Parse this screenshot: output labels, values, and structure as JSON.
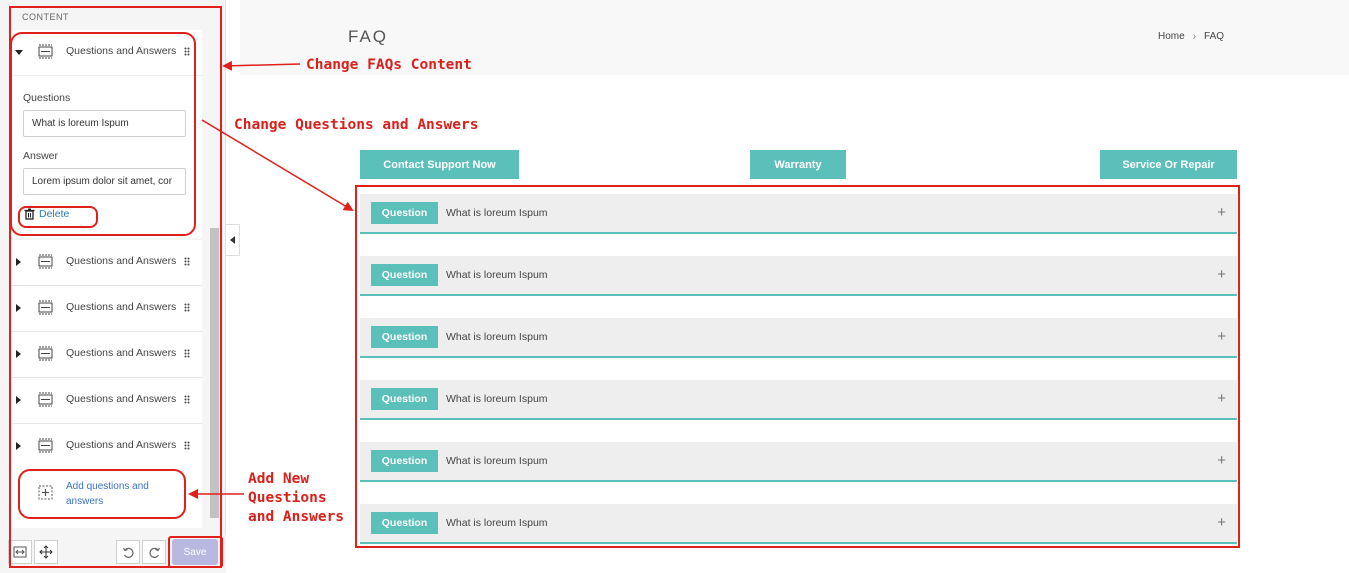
{
  "sidebar": {
    "section_label": "CONTENT",
    "item_label": "Questions and Answers",
    "expanded_item": {
      "question_label": "Questions",
      "question_value": "What is loreum Ispum",
      "answer_label": "Answer",
      "answer_value": "Lorem ipsum dolor sit amet, cor",
      "delete_label": "Delete"
    },
    "collapsed_items": [
      {
        "label": "Questions and Answers"
      },
      {
        "label": "Questions and Answers"
      },
      {
        "label": "Questions and Answers"
      },
      {
        "label": "Questions and Answers"
      },
      {
        "label": "Questions and Answers"
      }
    ],
    "add_label": "Add questions and answers",
    "save_label": "Save"
  },
  "preview": {
    "title": "FAQ",
    "breadcrumb": {
      "home": "Home",
      "separator": "›",
      "current": "FAQ"
    },
    "tabs": [
      {
        "label": "Contact Support Now"
      },
      {
        "label": "Warranty"
      },
      {
        "label": "Service Or Repair"
      }
    ],
    "faqs": [
      {
        "badge": "Question",
        "text": "What is loreum Ispum"
      },
      {
        "badge": "Question",
        "text": "What is loreum Ispum"
      },
      {
        "badge": "Question",
        "text": "What is loreum Ispum"
      },
      {
        "badge": "Question",
        "text": "What is loreum Ispum"
      },
      {
        "badge": "Question",
        "text": "What is loreum Ispum"
      },
      {
        "badge": "Question",
        "text": "What is loreum Ispum"
      }
    ],
    "expand_symbol": "+"
  },
  "annotations": {
    "change_faqs": "Change FAQs Content",
    "change_qa": "Change Questions and Answers",
    "add_new": [
      "Add New",
      "Questions",
      "and Answers"
    ]
  },
  "colors": {
    "accent": "#5bbfba",
    "annotation": "#e0201b",
    "save": "#b8b8e0",
    "link": "#2a7bb8"
  }
}
